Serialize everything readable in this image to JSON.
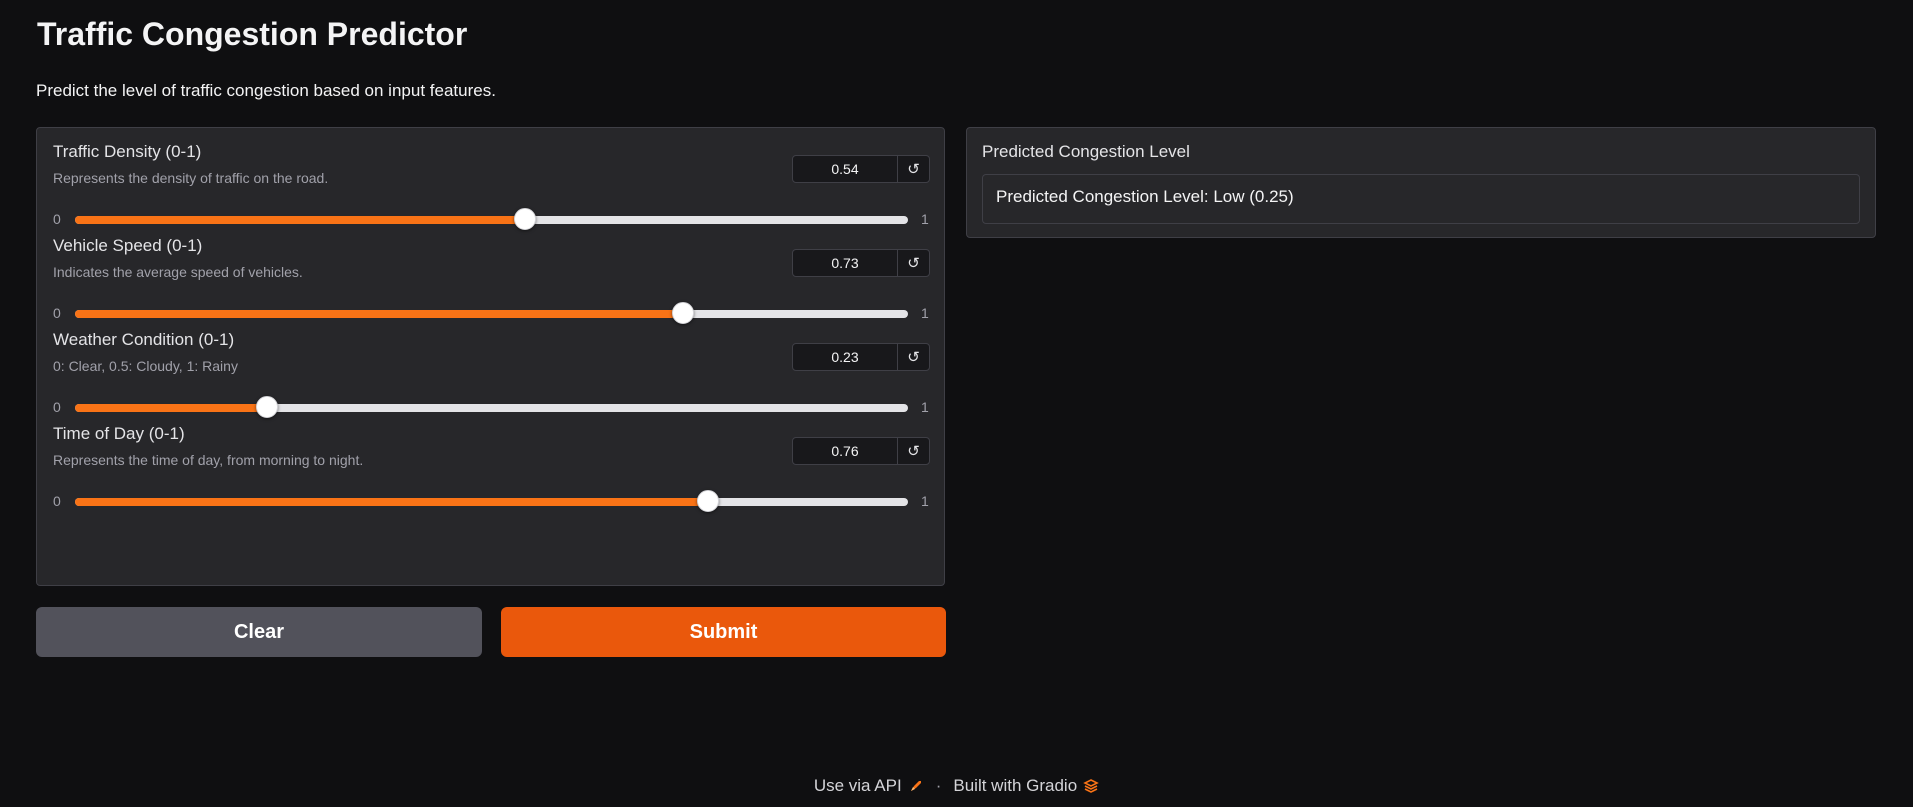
{
  "app": {
    "title": "Traffic Congestion Predictor",
    "description": "Predict the level of traffic congestion based on input features."
  },
  "inputs": [
    {
      "label": "Traffic Density (0-1)",
      "info": "Represents the density of traffic on the road.",
      "value": "0.54",
      "min": "0",
      "max": "1"
    },
    {
      "label": "Vehicle Speed (0-1)",
      "info": "Indicates the average speed of vehicles.",
      "value": "0.73",
      "min": "0",
      "max": "1"
    },
    {
      "label": "Weather Condition (0-1)",
      "info": "0: Clear, 0.5: Cloudy, 1: Rainy",
      "value": "0.23",
      "min": "0",
      "max": "1"
    },
    {
      "label": "Time of Day (0-1)",
      "info": "Represents the time of day, from morning to night.",
      "value": "0.76",
      "min": "0",
      "max": "1"
    }
  ],
  "reset_icon_char": "↺",
  "buttons": {
    "clear": "Clear",
    "submit": "Submit"
  },
  "output": {
    "label": "Predicted Congestion Level",
    "value": "Predicted Congestion Level: Low (0.25)"
  },
  "footer": {
    "api_link": "Use via API",
    "separator": "·",
    "built_with": "Built with Gradio"
  },
  "colors": {
    "accent": "#f97316",
    "submit": "#ea580c",
    "clear": "#52525b",
    "background": "#0f0f11",
    "panel": "#27272a"
  },
  "icons": {
    "reset": "reset-icon",
    "api": "rocket-icon",
    "gradio": "gradio-logo-icon"
  }
}
